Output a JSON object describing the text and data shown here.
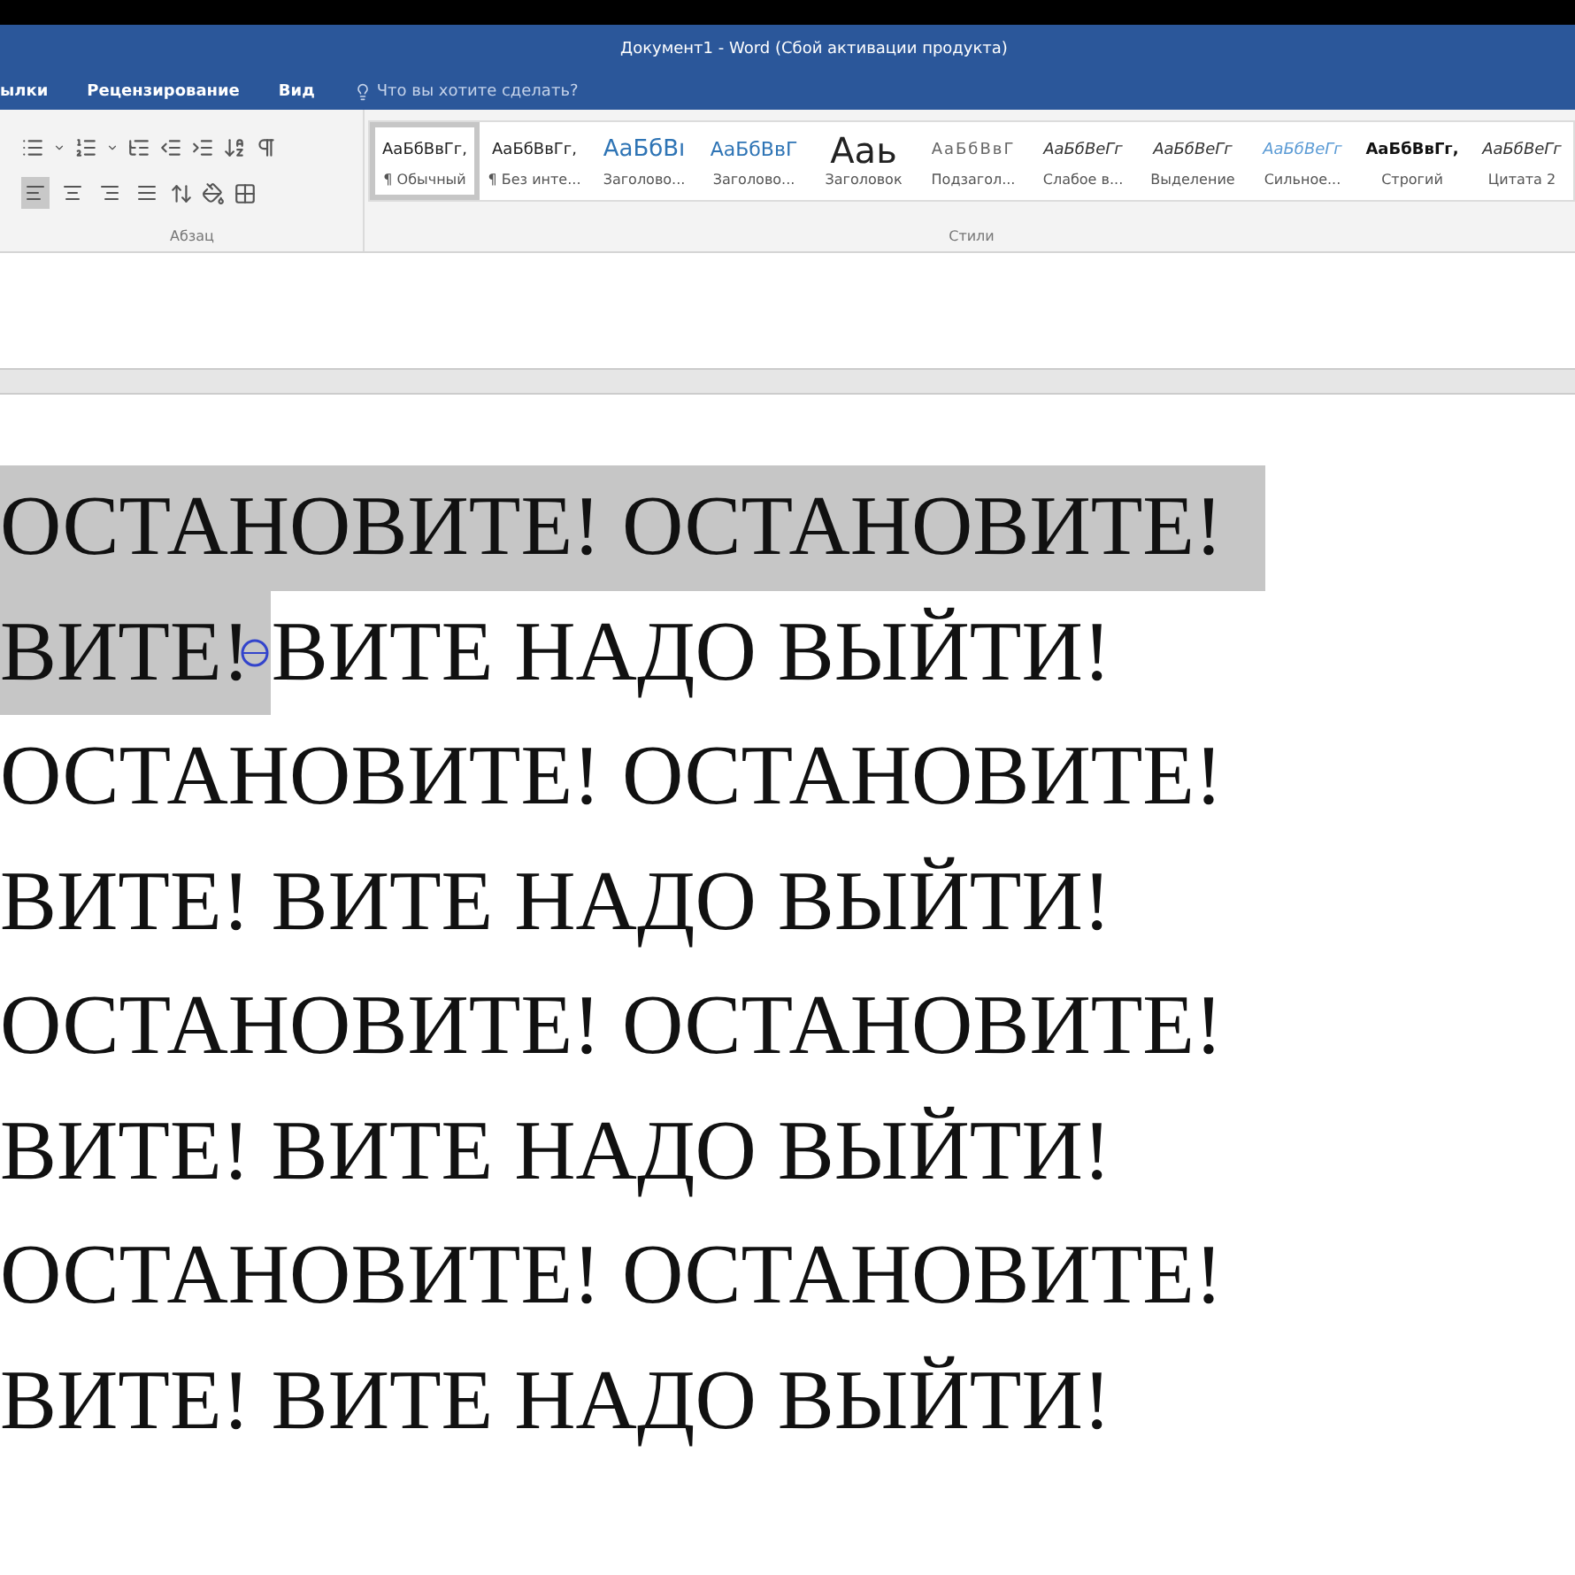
{
  "window": {
    "title": "Документ1 - Word (Сбой активации продукта)"
  },
  "tabs": [
    {
      "label": "ылки",
      "selected": false
    },
    {
      "label": "Рецензирование",
      "selected": false
    },
    {
      "label": "Вид",
      "selected": false
    }
  ],
  "tell_me": {
    "placeholder": "Что вы хотите сделать?"
  },
  "paragraph_group": {
    "label": "Абзац",
    "alignment": [
      {
        "selected": true
      },
      {
        "selected": false
      },
      {
        "selected": false
      },
      {
        "selected": false
      }
    ]
  },
  "styles_group": {
    "label": "Стили",
    "styles": [
      {
        "preview": "АаБбВвГг,",
        "name": "¶ Обычный",
        "kind": "normal",
        "selected": true
      },
      {
        "preview": "АаБбВвГг,",
        "name": "¶ Без инте...",
        "kind": "normal",
        "selected": false
      },
      {
        "preview": "АаБбВı",
        "name": "Заголово...",
        "kind": "heading1",
        "selected": false
      },
      {
        "preview": "АаБбВвГ",
        "name": "Заголово...",
        "kind": "heading2",
        "selected": false
      },
      {
        "preview": "Ааь",
        "name": "Заголовок",
        "kind": "title",
        "selected": false
      },
      {
        "preview": "АаБбВвГ",
        "name": "Подзагол...",
        "kind": "subtitle",
        "selected": false
      },
      {
        "preview": "АаБбВеГг",
        "name": "Слабое в...",
        "kind": "emphasis",
        "selected": false
      },
      {
        "preview": "АаБбВеГг",
        "name": "Выделение",
        "kind": "emphasis",
        "selected": false
      },
      {
        "preview": "АаБбВеГг",
        "name": "Сильное...",
        "kind": "intense",
        "selected": false
      },
      {
        "preview": "АаБбВвГг,",
        "name": "Строгий",
        "kind": "strong",
        "selected": false
      },
      {
        "preview": "АаБбВеГг",
        "name": "Цитата 2",
        "kind": "emphasis",
        "selected": false
      }
    ]
  },
  "document": {
    "lines": [
      {
        "segments": [
          {
            "text": "ОСТАНОВИТЕ! ОСТАНОВИТЕ!",
            "selected": true
          }
        ]
      },
      {
        "segments": [
          {
            "text": "ВИТЕ! ",
            "selected": true
          },
          {
            "text": "ВИТЕ НАДО ВЫЙТИ!",
            "selected": false
          }
        ]
      },
      {
        "segments": [
          {
            "text": "ОСТАНОВИТЕ! ОСТАНОВИТЕ!",
            "selected": false
          }
        ]
      },
      {
        "segments": [
          {
            "text": "ВИТЕ! ВИТЕ НАДО ВЫЙТИ!",
            "selected": false
          }
        ]
      },
      {
        "segments": [
          {
            "text": "ОСТАНОВИТЕ! ОСТАНОВИТЕ!",
            "selected": false
          }
        ]
      },
      {
        "segments": [
          {
            "text": "ВИТЕ! ВИТЕ НАДО ВЫЙТИ!",
            "selected": false
          }
        ]
      },
      {
        "segments": [
          {
            "text": "ОСТАНОВИТЕ! ОСТАНОВИТЕ!",
            "selected": false
          }
        ]
      },
      {
        "segments": [
          {
            "text": "ВИТЕ! ВИТЕ НАДО ВЫЙТИ!",
            "selected": false
          }
        ]
      }
    ]
  }
}
